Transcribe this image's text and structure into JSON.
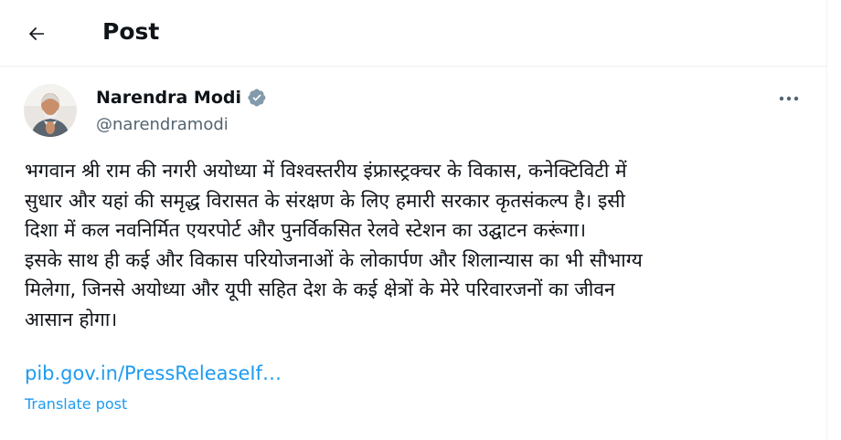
{
  "header": {
    "title": "Post"
  },
  "author": {
    "name": "Narendra Modi",
    "handle": "@narendramodi",
    "verified": true
  },
  "post": {
    "text": "भगवान श्री राम की नगरी अयोध्या में विश्वस्तरीय इंफ्रास्ट्रक्चर के विकास, कनेक्टिविटी में\nसुधार और यहां की समृद्ध विरासत के संरक्षण के लिए हमारी सरकार कृतसंकल्प है। इसी\nदिशा में कल नवनिर्मित एयरपोर्ट और पुनर्विकसित रेलवे स्टेशन का उद्घाटन करूंगा।\nइसके साथ ही कई और विकास परियोजनाओं के लोकार्पण और शिलान्यास का भी सौभाग्य\nमिलेगा, जिनसे अयोध्या और यूपी सहित देश के कई क्षेत्रों के मेरे परिवारजनों का जीवन\nआसान होगा।",
    "link": "pib.gov.in/PressReleaseIf…",
    "translate_label": "Translate post"
  },
  "colors": {
    "text": "#0f1419",
    "secondary": "#536471",
    "accent": "#1d9bf0",
    "divider": "#eff3f4",
    "verified_badge": "#829aab"
  },
  "icons": {
    "back": "arrow-left-icon",
    "verified": "verified-badge-icon",
    "more": "more-horizontal-icon"
  }
}
